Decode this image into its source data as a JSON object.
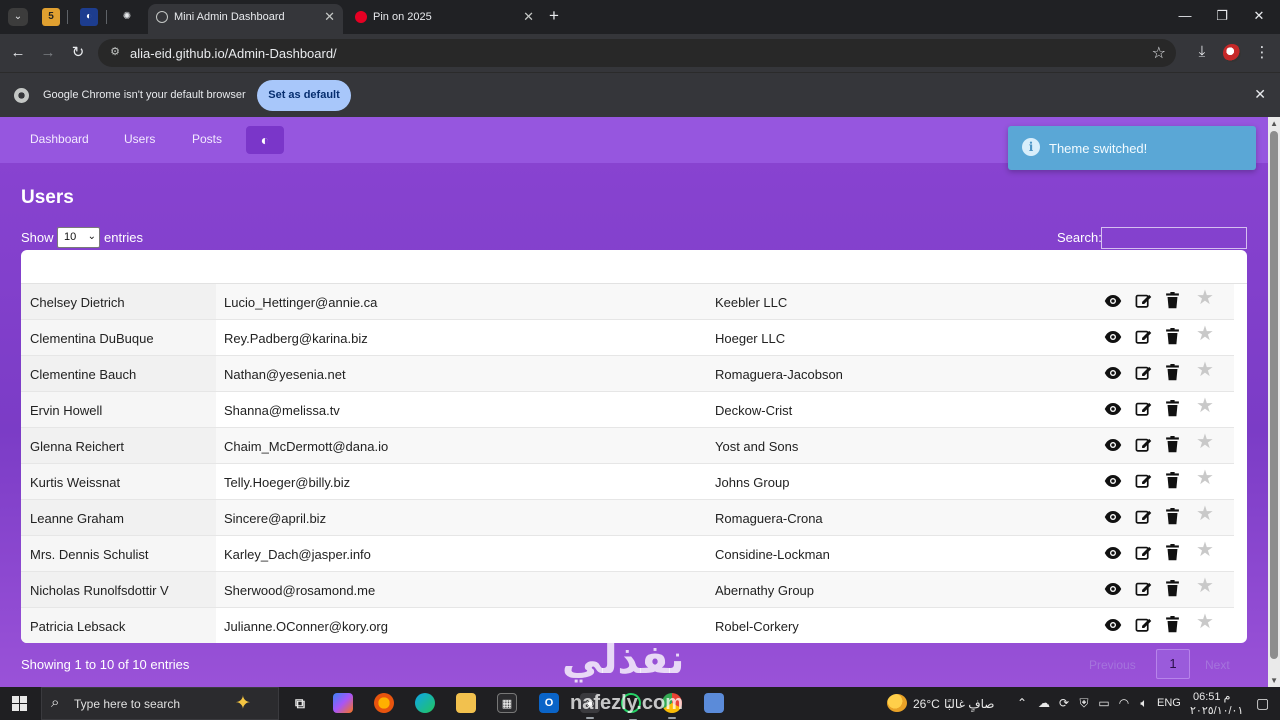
{
  "browser": {
    "tabs": [
      {
        "title": "Mini Admin Dashboard",
        "active": true
      },
      {
        "title": "Pin on 2025",
        "active": false
      }
    ],
    "url": "alia-eid.github.io/Admin-Dashboard/",
    "infobar": {
      "message": "Google Chrome isn't your default browser",
      "button": "Set as default"
    }
  },
  "nav": {
    "links": [
      "Dashboard",
      "Users",
      "Posts"
    ],
    "theme_icon": "half-circle-icon"
  },
  "toast": {
    "message": "Theme switched!",
    "icon": "info-icon"
  },
  "users": {
    "heading": "Users",
    "show_label": "Show",
    "page_length": "10",
    "entries_label": "entries",
    "search_label": "Search:",
    "search_value": "",
    "rows": [
      {
        "name": "Chelsey Dietrich",
        "email": "Lucio_Hettinger@annie.ca",
        "company": "Keebler LLC"
      },
      {
        "name": "Clementina DuBuque",
        "email": "Rey.Padberg@karina.biz",
        "company": "Hoeger LLC"
      },
      {
        "name": "Clementine Bauch",
        "email": "Nathan@yesenia.net",
        "company": "Romaguera-Jacobson"
      },
      {
        "name": "Ervin Howell",
        "email": "Shanna@melissa.tv",
        "company": "Deckow-Crist"
      },
      {
        "name": "Glenna Reichert",
        "email": "Chaim_McDermott@dana.io",
        "company": "Yost and Sons"
      },
      {
        "name": "Kurtis Weissnat",
        "email": "Telly.Hoeger@billy.biz",
        "company": "Johns Group"
      },
      {
        "name": "Leanne Graham",
        "email": "Sincere@april.biz",
        "company": "Romaguera-Crona"
      },
      {
        "name": "Mrs. Dennis Schulist",
        "email": "Karley_Dach@jasper.info",
        "company": "Considine-Lockman"
      },
      {
        "name": "Nicholas Runolfsdottir V",
        "email": "Sherwood@rosamond.me",
        "company": "Abernathy Group"
      },
      {
        "name": "Patricia Lebsack",
        "email": "Julianne.OConner@kory.org",
        "company": "Robel-Corkery"
      }
    ],
    "row_action_icons": [
      "eye-icon",
      "edit-icon",
      "trash-icon",
      "star-icon"
    ],
    "info": "Showing 1 to 10 of 10 entries",
    "pagination": {
      "previous": "Previous",
      "current": "1",
      "next": "Next"
    }
  },
  "watermark": {
    "arabic": "نفذلي",
    "latin": "nafezly.com"
  },
  "taskbar": {
    "search_placeholder": "Type here to search",
    "temperature": "26°C",
    "weather_condition": "صافٍ غالبًا",
    "language": "ENG",
    "time": "06:51 م",
    "date": "٢٠٢٥/١٠/٠١"
  },
  "colors": {
    "page_bg": "#8a44d2",
    "nav_bg": "#9656df",
    "toast_bg": "#5aa7d6",
    "set_default_btn": "#a8c7fa"
  }
}
